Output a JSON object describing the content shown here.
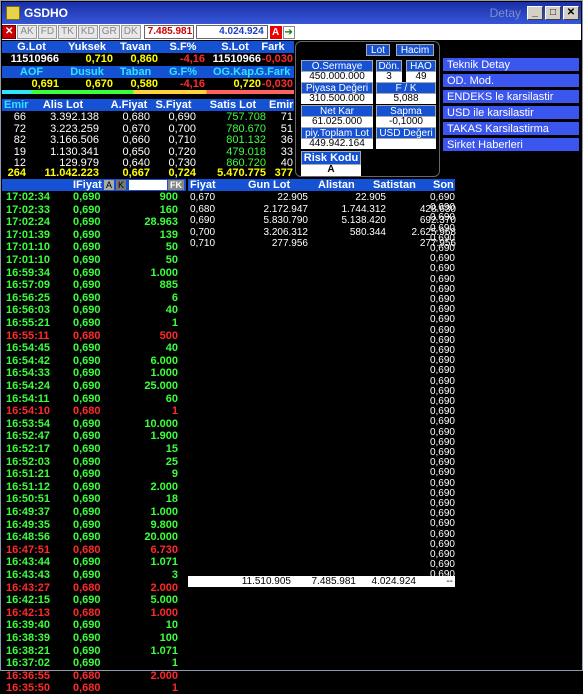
{
  "window": {
    "title": "GSDHO",
    "detay": "Detay"
  },
  "toolbar": {
    "buttons": [
      "AK",
      "FD",
      "TK",
      "KD",
      "GR",
      "DK"
    ],
    "value_red": "7.485.981",
    "value_blue": "4.024.924",
    "a_label": "A"
  },
  "summary": {
    "h1": [
      "G.Lot",
      "Yuksek",
      "Tavan",
      "S.F%",
      "S.Lot",
      "Fark"
    ],
    "r1": [
      "11510966",
      "0,710",
      "0,860",
      "-4,16",
      "11510966",
      "-0,030"
    ],
    "h2": [
      "AOF",
      "Dusuk",
      "Taban",
      "G.F%",
      "OG.Kap.",
      "G.Fark"
    ],
    "r2": [
      "0,691",
      "0,670",
      "0,580",
      "-4,16",
      "0,720",
      "-0,030"
    ]
  },
  "depth": {
    "headers": [
      "Emir",
      "Alis Lot",
      "A.Fiyat",
      "S.Fiyat",
      "Satis Lot",
      "Emir"
    ],
    "rows": [
      [
        "66",
        "3.392.138",
        "0,680",
        "0,690",
        "757.708",
        "71"
      ],
      [
        "72",
        "3.223.259",
        "0,670",
        "0,700",
        "780.670",
        "51"
      ],
      [
        "82",
        "3.166.506",
        "0,660",
        "0,710",
        "801.132",
        "36"
      ],
      [
        "19",
        "1.130.341",
        "0,650",
        "0,720",
        "479.018",
        "33"
      ],
      [
        "12",
        "129.979",
        "0,640",
        "0,730",
        "860.720",
        "40"
      ]
    ],
    "total": [
      "264",
      "11.042.223",
      "0,667",
      "0,724",
      "5.470.775",
      "377"
    ]
  },
  "info_panel": {
    "lot": "Lot",
    "hacim": "Hacim",
    "o_sermaye_label": "O.Sermaye",
    "o_sermaye": "450.000.000",
    "don_label": "Dön.",
    "don": "3",
    "hao_label": "HAO",
    "hao": "49",
    "piyasa_label": "Piyasa Değeri",
    "piyasa": "310.500.000",
    "fk_label": "F / K",
    "fk": "5,088",
    "netkar_label": "Net Kar",
    "netkar": "61.025.000",
    "sapma_label": "Sapma",
    "sapma": "-0,1000",
    "piyt_label": "piy.Toplam Lot",
    "piyt": "449.942.164",
    "usd_label": "USD Değeri",
    "risk_label": "Risk Kodu",
    "risk": "A"
  },
  "side_menu": [
    "Teknik Detay",
    "OD. Mod.",
    "ENDEKS le karsilastir",
    "USD ile karsilastir",
    "TAKAS Karsilastirma",
    "Sirket Haberleri"
  ],
  "trades": {
    "headers": [
      "",
      "IFiyat",
      "",
      "FK"
    ],
    "sort_a": "A",
    "sort_k": "K",
    "rows": [
      [
        "17:02:34",
        "0,690",
        "900",
        "g"
      ],
      [
        "17:02:33",
        "0,690",
        "160",
        "g"
      ],
      [
        "17:02:24",
        "0,690",
        "28.963",
        "g"
      ],
      [
        "17:01:39",
        "0,690",
        "139",
        "g"
      ],
      [
        "17:01:10",
        "0,690",
        "50",
        "g"
      ],
      [
        "17:01:10",
        "0,690",
        "50",
        "g"
      ],
      [
        "16:59:34",
        "0,690",
        "1.000",
        "g"
      ],
      [
        "16:57:09",
        "0,690",
        "885",
        "g"
      ],
      [
        "16:56:25",
        "0,690",
        "6",
        "g"
      ],
      [
        "16:56:03",
        "0,690",
        "40",
        "g"
      ],
      [
        "16:55:21",
        "0,690",
        "1",
        "g"
      ],
      [
        "16:55:11",
        "0,680",
        "500",
        "r"
      ],
      [
        "16:54:45",
        "0,690",
        "40",
        "g"
      ],
      [
        "16:54:42",
        "0,690",
        "6.000",
        "g"
      ],
      [
        "16:54:33",
        "0,690",
        "1.000",
        "g"
      ],
      [
        "16:54:24",
        "0,690",
        "25.000",
        "g"
      ],
      [
        "16:54:11",
        "0,690",
        "60",
        "g"
      ],
      [
        "16:54:10",
        "0,680",
        "1",
        "r"
      ],
      [
        "16:53:54",
        "0,690",
        "10.000",
        "g"
      ],
      [
        "16:52:47",
        "0,690",
        "1.900",
        "g"
      ],
      [
        "16:52:17",
        "0,690",
        "15",
        "g"
      ],
      [
        "16:52:03",
        "0,690",
        "25",
        "g"
      ],
      [
        "16:51:21",
        "0,690",
        "9",
        "g"
      ],
      [
        "16:51:12",
        "0,690",
        "2.000",
        "g"
      ],
      [
        "16:50:51",
        "0,690",
        "18",
        "g"
      ],
      [
        "16:49:37",
        "0,690",
        "1.000",
        "g"
      ],
      [
        "16:49:35",
        "0,690",
        "9.800",
        "g"
      ],
      [
        "16:48:56",
        "0,690",
        "20.000",
        "g"
      ],
      [
        "16:47:51",
        "0,680",
        "6.730",
        "r"
      ],
      [
        "16:43:44",
        "0,690",
        "1.071",
        "g"
      ],
      [
        "16:43:43",
        "0,690",
        "3",
        "g"
      ],
      [
        "16:43:27",
        "0,680",
        "2.000",
        "r"
      ],
      [
        "16:42:15",
        "0,690",
        "5.000",
        "g"
      ],
      [
        "16:42:13",
        "0,680",
        "1.000",
        "r"
      ],
      [
        "16:39:40",
        "0,690",
        "10",
        "g"
      ],
      [
        "16:38:39",
        "0,690",
        "100",
        "g"
      ],
      [
        "16:38:21",
        "0,690",
        "1.071",
        "g"
      ],
      [
        "16:37:02",
        "0,690",
        "1",
        "g"
      ],
      [
        "16:36:55",
        "0,680",
        "2.000",
        "r"
      ],
      [
        "16:35:50",
        "0,680",
        "1",
        "r"
      ]
    ]
  },
  "dist": {
    "headers": [
      "Fiyat",
      "Gun Lot",
      "Alistan",
      "Satistan",
      "Son"
    ],
    "rows": [
      [
        "0,670",
        "22.905",
        "22.905",
        "",
        ""
      ],
      [
        "0,680",
        "2.172.947",
        "1.744.312",
        "428.630",
        ""
      ],
      [
        "0,690",
        "5.830.790",
        "5.138.420",
        "692.370",
        ""
      ],
      [
        "0,700",
        "3.206.312",
        "580.344",
        "2.625.968",
        ""
      ],
      [
        "0,710",
        "277.956",
        "",
        "277.956",
        ""
      ]
    ],
    "son": [
      "0,690",
      "0,690",
      "0,690",
      "0,690",
      "0,690",
      "0,690",
      "0,690",
      "0,690",
      "0,690",
      "0,690",
      "0,690",
      "0,690",
      "0,690",
      "0,690",
      "0,690",
      "0,690",
      "0,690",
      "0,690",
      "0,690",
      "0,690",
      "0,690",
      "0,690",
      "0,690",
      "0,690",
      "0,690",
      "0,690",
      "0,690",
      "0,690",
      "0,690",
      "0,690",
      "0,690",
      "0,690",
      "0,690",
      "0,690",
      "0,690",
      "0,690",
      "0,690",
      "0,690"
    ],
    "total": [
      "11.510.905",
      "7.485.981",
      "4.024.924",
      "--"
    ]
  }
}
